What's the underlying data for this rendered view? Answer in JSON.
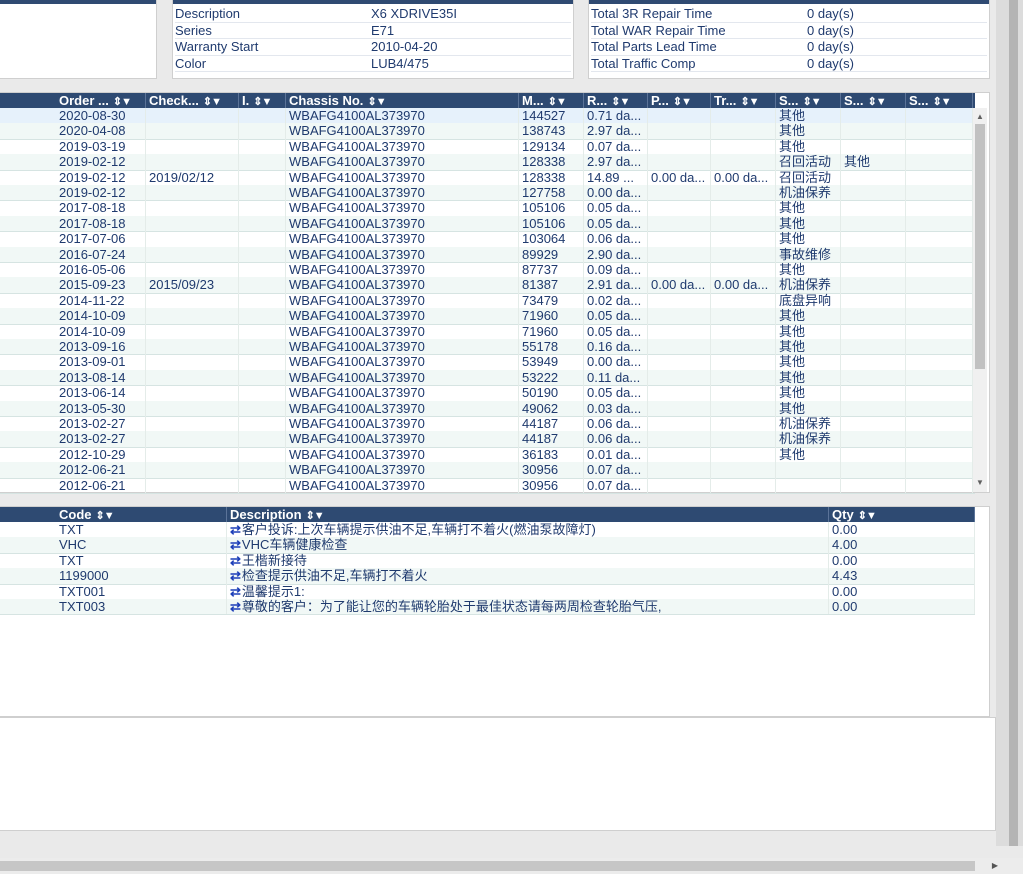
{
  "vehicle_info": [
    {
      "label": "Description",
      "value": "X6 XDRIVE35I"
    },
    {
      "label": "Series",
      "value": "E71"
    },
    {
      "label": "Warranty Start",
      "value": "2010-04-20"
    },
    {
      "label": "Color",
      "value": "LUB4/475"
    }
  ],
  "repair_summary": [
    {
      "label": "Total 3R Repair Time",
      "value": "0 day(s)"
    },
    {
      "label": "Total WAR Repair Time",
      "value": "0 day(s)"
    },
    {
      "label": "Total Parts Lead Time",
      "value": "0 day(s)"
    },
    {
      "label": "Total Traffic Comp",
      "value": "0 day(s)"
    }
  ],
  "orders": {
    "columns": [
      "Order ...",
      "Check...",
      "I.",
      "Chassis No.",
      "M...",
      "R...",
      "P...",
      "Tr...",
      "S...",
      "S...",
      "S..."
    ],
    "rows": [
      [
        "2020-08-30",
        "",
        "",
        "WBAFG4100AL373970",
        "144527",
        "0.71 da...",
        "",
        "",
        "其他",
        "",
        ""
      ],
      [
        "2020-04-08",
        "",
        "",
        "WBAFG4100AL373970",
        "138743",
        "2.97 da...",
        "",
        "",
        "其他",
        "",
        ""
      ],
      [
        "2019-03-19",
        "",
        "",
        "WBAFG4100AL373970",
        "129134",
        "0.07 da...",
        "",
        "",
        "其他",
        "",
        ""
      ],
      [
        "2019-02-12",
        "",
        "",
        "WBAFG4100AL373970",
        "128338",
        "2.97 da...",
        "",
        "",
        "召回活动",
        "其他",
        ""
      ],
      [
        "2019-02-12",
        "2019/02/12",
        "",
        "WBAFG4100AL373970",
        "128338",
        "14.89 ...",
        "0.00 da...",
        "0.00 da...",
        "召回活动",
        "",
        ""
      ],
      [
        "2019-02-12",
        "",
        "",
        "WBAFG4100AL373970",
        "127758",
        "0.00 da...",
        "",
        "",
        "机油保养",
        "",
        ""
      ],
      [
        "2017-08-18",
        "",
        "",
        "WBAFG4100AL373970",
        "105106",
        "0.05 da...",
        "",
        "",
        "其他",
        "",
        ""
      ],
      [
        "2017-08-18",
        "",
        "",
        "WBAFG4100AL373970",
        "105106",
        "0.05 da...",
        "",
        "",
        "其他",
        "",
        ""
      ],
      [
        "2017-07-06",
        "",
        "",
        "WBAFG4100AL373970",
        "103064",
        "0.06 da...",
        "",
        "",
        "其他",
        "",
        ""
      ],
      [
        "2016-07-24",
        "",
        "",
        "WBAFG4100AL373970",
        "89929",
        "2.90 da...",
        "",
        "",
        "事故维修",
        "",
        ""
      ],
      [
        "2016-05-06",
        "",
        "",
        "WBAFG4100AL373970",
        "87737",
        "0.09 da...",
        "",
        "",
        "其他",
        "",
        ""
      ],
      [
        "2015-09-23",
        "2015/09/23",
        "",
        "WBAFG4100AL373970",
        "81387",
        "2.91 da...",
        "0.00 da...",
        "0.00 da...",
        "机油保养",
        "",
        ""
      ],
      [
        "2014-11-22",
        "",
        "",
        "WBAFG4100AL373970",
        "73479",
        "0.02 da...",
        "",
        "",
        "底盘异响",
        "",
        ""
      ],
      [
        "2014-10-09",
        "",
        "",
        "WBAFG4100AL373970",
        "71960",
        "0.05 da...",
        "",
        "",
        "其他",
        "",
        ""
      ],
      [
        "2014-10-09",
        "",
        "",
        "WBAFG4100AL373970",
        "71960",
        "0.05 da...",
        "",
        "",
        "其他",
        "",
        ""
      ],
      [
        "2013-09-16",
        "",
        "",
        "WBAFG4100AL373970",
        "55178",
        "0.16 da...",
        "",
        "",
        "其他",
        "",
        ""
      ],
      [
        "2013-09-01",
        "",
        "",
        "WBAFG4100AL373970",
        "53949",
        "0.00 da...",
        "",
        "",
        "其他",
        "",
        ""
      ],
      [
        "2013-08-14",
        "",
        "",
        "WBAFG4100AL373970",
        "53222",
        "0.11 da...",
        "",
        "",
        "其他",
        "",
        ""
      ],
      [
        "2013-06-14",
        "",
        "",
        "WBAFG4100AL373970",
        "50190",
        "0.05 da...",
        "",
        "",
        "其他",
        "",
        ""
      ],
      [
        "2013-05-30",
        "",
        "",
        "WBAFG4100AL373970",
        "49062",
        "0.03 da...",
        "",
        "",
        "其他",
        "",
        ""
      ],
      [
        "2013-02-27",
        "",
        "",
        "WBAFG4100AL373970",
        "44187",
        "0.06 da...",
        "",
        "",
        "机油保养",
        "",
        ""
      ],
      [
        "2013-02-27",
        "",
        "",
        "WBAFG4100AL373970",
        "44187",
        "0.06 da...",
        "",
        "",
        "机油保养",
        "",
        ""
      ],
      [
        "2012-10-29",
        "",
        "",
        "WBAFG4100AL373970",
        "36183",
        "0.01 da...",
        "",
        "",
        "其他",
        "",
        ""
      ],
      [
        "2012-06-21",
        "",
        "",
        "WBAFG4100AL373970",
        "30956",
        "0.07 da...",
        "",
        "",
        "",
        "",
        ""
      ],
      [
        "2012-06-21",
        "",
        "",
        "WBAFG4100AL373970",
        "30956",
        "0.07 da...",
        "",
        "",
        "",
        "",
        ""
      ]
    ]
  },
  "jobs": {
    "columns": [
      "Code",
      "Description",
      "Qty"
    ],
    "rows": [
      [
        "TXT",
        "客户投诉:上次车辆提示供油不足,车辆打不着火(燃油泵故障灯)",
        "0.00"
      ],
      [
        "VHC",
        "VHC车辆健康检查",
        "4.00"
      ],
      [
        "TXT",
        "王楷新接待",
        "0.00"
      ],
      [
        "1199000",
        "检查提示供油不足,车辆打不着火",
        "4.43"
      ],
      [
        "TXT001",
        "温馨提示1:",
        "0.00"
      ],
      [
        "TXT003",
        "尊敬的客户：为了能让您的车辆轮胎处于最佳状态请每两周检查轮胎气压,",
        "0.00"
      ]
    ]
  },
  "icons": {
    "sort": "sort-icon",
    "filter": "filter-icon",
    "swap": "swap-icon"
  },
  "colors": {
    "header": "#2e4a72",
    "text": "#1f3a6e",
    "row_alt": "#f1f8f6",
    "selected": "#e6f1fb"
  }
}
